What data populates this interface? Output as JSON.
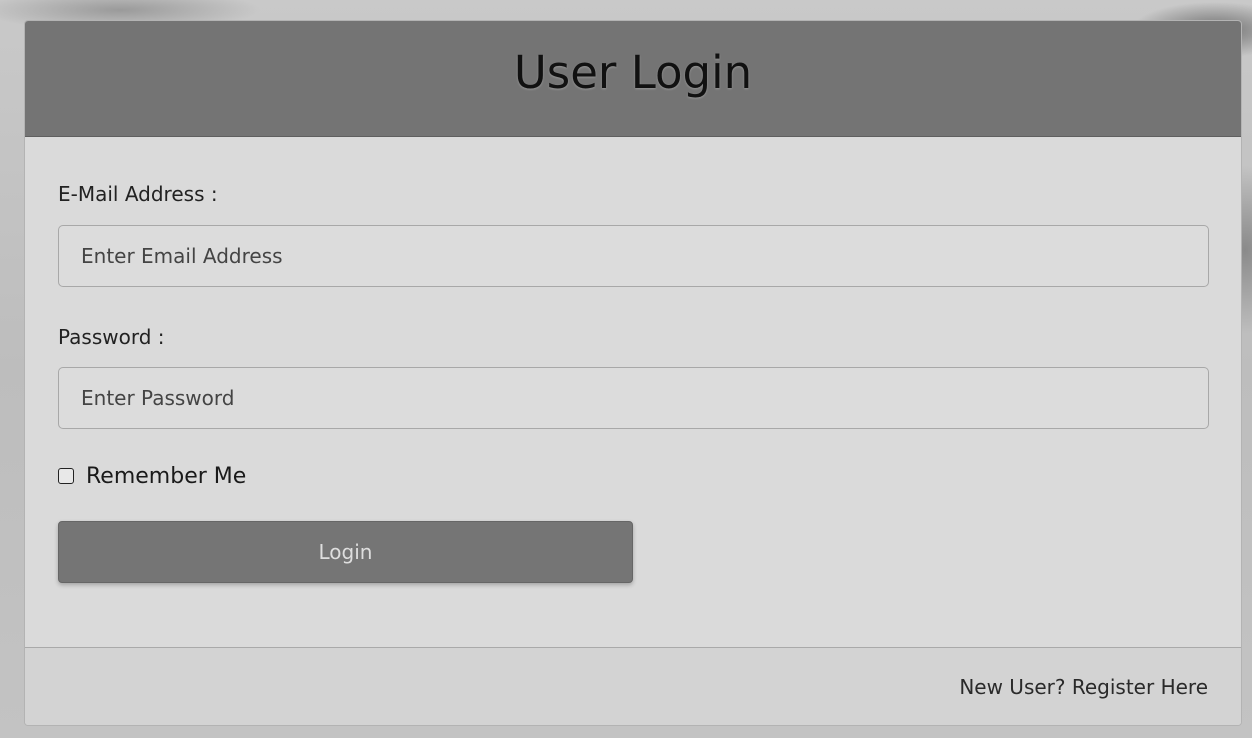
{
  "header": {
    "title": "User Login"
  },
  "form": {
    "email": {
      "label": "E-Mail Address :",
      "placeholder": "Enter Email Address",
      "value": ""
    },
    "password": {
      "label": "Password :",
      "placeholder": "Enter Password",
      "value": ""
    },
    "remember": {
      "label": "Remember Me",
      "checked": false
    },
    "submit_label": "Login"
  },
  "footer": {
    "register_link": "New User? Register Here"
  },
  "colors": {
    "header_bg": "#747474",
    "card_bg": "#dadada",
    "button_bg": "#757575",
    "footer_bg": "#d3d3d3"
  }
}
